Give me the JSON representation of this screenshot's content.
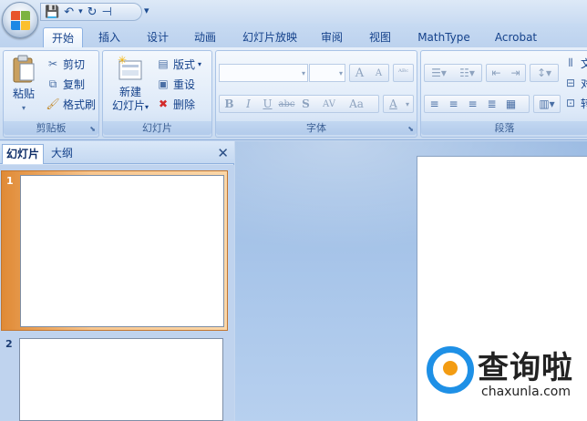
{
  "qat": {
    "save": "💾",
    "undo": "↶",
    "undo_more": "▾",
    "redo": "↻",
    "print": "⊣",
    "more": "▾"
  },
  "tabs": [
    "开始",
    "插入",
    "设计",
    "动画",
    "幻灯片放映",
    "审阅",
    "视图",
    "MathType",
    "Acrobat"
  ],
  "ribbon": {
    "clipboard": {
      "label": "剪贴板",
      "paste": "粘贴",
      "cut": "剪切",
      "copy": "复制",
      "format_painter": "格式刷"
    },
    "slides": {
      "label": "幻灯片",
      "new_slide_line1": "新建",
      "new_slide_line2": "幻灯片",
      "layout": "版式",
      "reset": "重设",
      "delete": "删除"
    },
    "font": {
      "label": "字体",
      "bold": "B",
      "italic": "I",
      "underline": "U",
      "strike": "abc",
      "shadow": "S",
      "spacing": "AV",
      "case": "Aa",
      "color": "A",
      "grow": "A",
      "shrink": "A"
    },
    "paragraph": {
      "label": "段落",
      "text_dir_partial": "文",
      "align_partial": "对",
      "convert_partial": "转"
    }
  },
  "panel": {
    "tab_slides": "幻灯片",
    "tab_outline": "大纲",
    "close": "✕",
    "slide_numbers": [
      "1",
      "2"
    ]
  },
  "watermark": {
    "brand": "查询啦",
    "url": "chaxunla.com"
  },
  "colors": {
    "ribbon_blue": "#15428b",
    "selected_orange": "#e08a36",
    "watermark_blue": "#1e90e6",
    "watermark_orange": "#f39c12"
  }
}
